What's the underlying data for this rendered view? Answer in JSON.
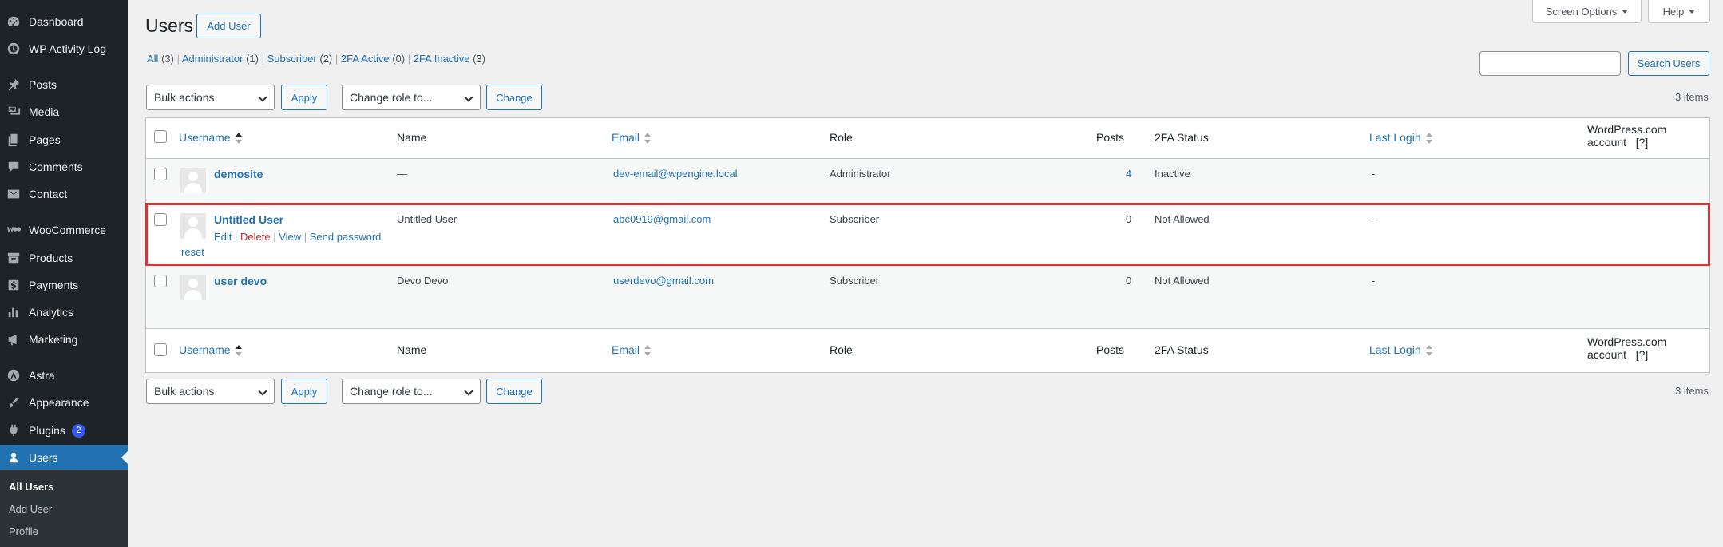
{
  "sidebar": {
    "items": [
      {
        "label": "Dashboard",
        "icon": "dashboard-icon"
      },
      {
        "label": "WP Activity Log",
        "icon": "activity-log-icon"
      },
      {
        "label": "Posts",
        "icon": "pin-icon"
      },
      {
        "label": "Media",
        "icon": "media-icon"
      },
      {
        "label": "Pages",
        "icon": "pages-icon"
      },
      {
        "label": "Comments",
        "icon": "comment-icon"
      },
      {
        "label": "Contact",
        "icon": "mail-icon"
      },
      {
        "label": "WooCommerce",
        "icon": "woocommerce-icon"
      },
      {
        "label": "Products",
        "icon": "archive-icon"
      },
      {
        "label": "Payments",
        "icon": "dollar-icon"
      },
      {
        "label": "Analytics",
        "icon": "bar-chart-icon"
      },
      {
        "label": "Marketing",
        "icon": "megaphone-icon"
      },
      {
        "label": "Astra",
        "icon": "astra-icon"
      },
      {
        "label": "Appearance",
        "icon": "paintbrush-icon"
      },
      {
        "label": "Plugins",
        "icon": "plugin-icon",
        "badge": "2"
      },
      {
        "label": "Users",
        "icon": "user-icon",
        "current": true
      }
    ],
    "submenu": [
      "All Users",
      "Add User",
      "Profile"
    ]
  },
  "header": {
    "title": "Users",
    "add_button": "Add User",
    "screen_options": "Screen Options",
    "help": "Help"
  },
  "filters": [
    {
      "label": "All",
      "count": "(3)"
    },
    {
      "label": "Administrator",
      "count": "(1)"
    },
    {
      "label": "Subscriber",
      "count": "(2)"
    },
    {
      "label": "2FA Active",
      "count": "(0)"
    },
    {
      "label": "2FA Inactive",
      "count": "(3)"
    }
  ],
  "search": {
    "value": "",
    "button": "Search Users"
  },
  "tablenav": {
    "bulk_actions": "Bulk actions",
    "apply": "Apply",
    "change_role": "Change role to...",
    "change": "Change",
    "items_count": "3 items"
  },
  "columns": {
    "username": "Username",
    "name": "Name",
    "email": "Email",
    "role": "Role",
    "posts": "Posts",
    "twofa": "2FA Status",
    "last_login": "Last Login",
    "wpcom_line1": "WordPress.com",
    "wpcom_line2": "account",
    "wpcom_help": "[?]"
  },
  "rows": [
    {
      "username": "demosite",
      "name": "—",
      "email": "dev-email@wpengine.local",
      "role": "Administrator",
      "posts": "4",
      "twofa": "Inactive",
      "last_login": "-"
    },
    {
      "username": "Untitled User",
      "name": "Untitled User",
      "email": "abc0919@gmail.com",
      "role": "Subscriber",
      "posts": "0",
      "twofa": "Not Allowed",
      "last_login": "-",
      "actions": {
        "edit": "Edit",
        "delete": "Delete",
        "view": "View",
        "send_reset_1": "Send password",
        "send_reset_2": "reset"
      }
    },
    {
      "username": "user devo",
      "name": "Devo Devo",
      "email": "userdevo@gmail.com",
      "role": "Subscriber",
      "posts": "0",
      "twofa": "Not Allowed",
      "last_login": "-"
    }
  ],
  "colors": {
    "accent": "#2271b1",
    "highlight": "#d63638",
    "sidebar": "#1d2327",
    "current": "#2271b1"
  }
}
